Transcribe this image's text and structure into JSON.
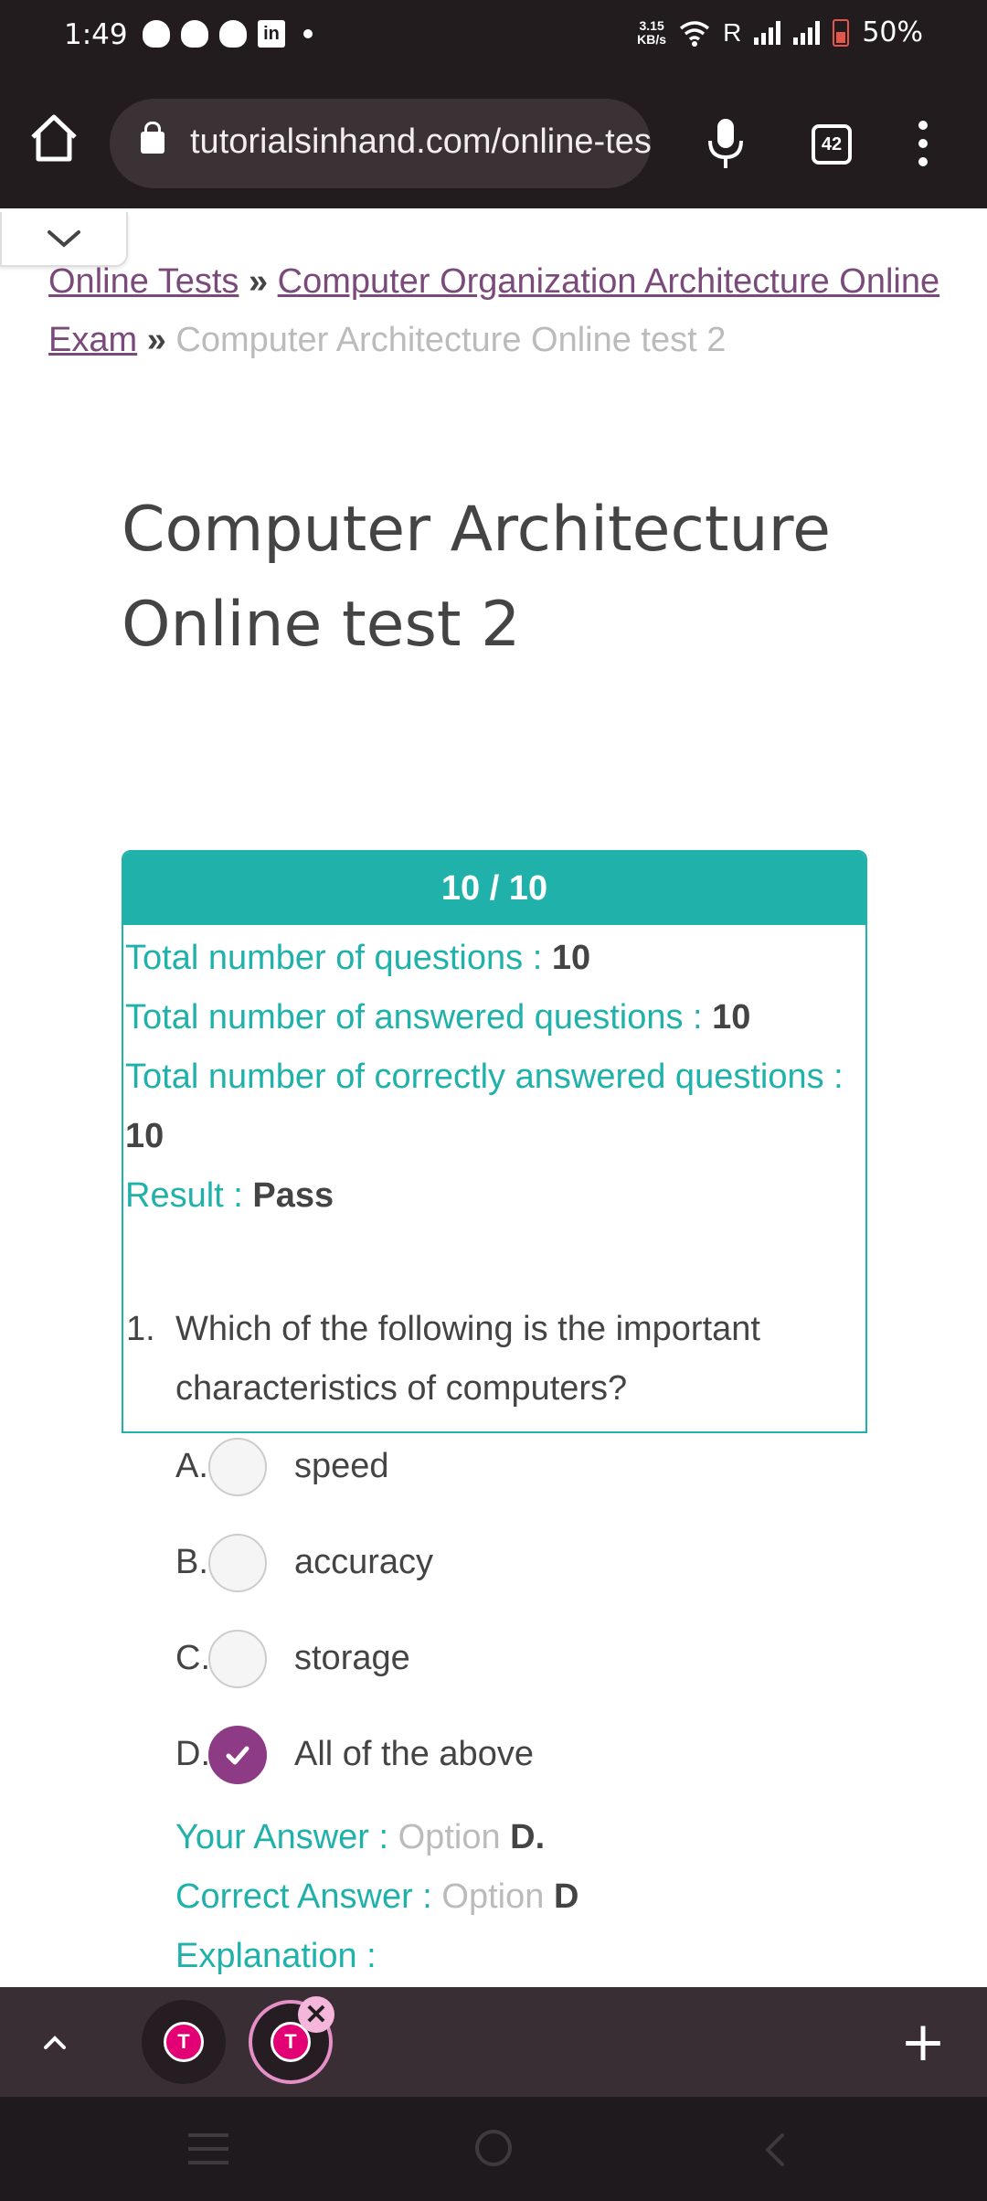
{
  "status_bar": {
    "time": "1:49",
    "net_speed_value": "3.15",
    "net_speed_unit": "KB/s",
    "roaming": "R",
    "battery": "50%"
  },
  "browser": {
    "url": "tutorialsinhand.com/online-tests",
    "tab_count": "42"
  },
  "breadcrumb": {
    "link1": "Online Tests",
    "sep": "»",
    "link2": "Computer Organization Architecture Online Exam",
    "current": "Computer Architecture Online test 2"
  },
  "page": {
    "title": "Computer Architecture Online test 2"
  },
  "result": {
    "score": "10 / 10",
    "total_label": "Total number of questions : ",
    "total_value": "10",
    "answered_label": "Total number of answered questions : ",
    "answered_value": "10",
    "correct_label": "Total number of correctly answered questions : ",
    "correct_value": "10",
    "result_label": "Result : ",
    "result_value": "Pass"
  },
  "question1": {
    "number": "1.",
    "text": "Which of the following is the important characteristics of computers?",
    "options": [
      {
        "letter": "A.",
        "text": "speed"
      },
      {
        "letter": "B.",
        "text": "accuracy"
      },
      {
        "letter": "C.",
        "text": "storage"
      },
      {
        "letter": "D.",
        "text": "All of the above"
      }
    ],
    "your_answer_label": "Your Answer : ",
    "your_answer_opt": "Option ",
    "your_answer_value": "D.",
    "correct_answer_label": "Correct Answer : ",
    "correct_answer_opt": "Option ",
    "correct_answer_value": "D",
    "explanation_label": "Explanation :"
  },
  "tabstrip": {
    "tab_logo": "T",
    "close": "✕",
    "plus": "+"
  },
  "colors": {
    "teal": "#20b2aa",
    "purple": "#8d3b84",
    "link": "#7a4a7a",
    "chrome_dark": "#221c1f"
  }
}
